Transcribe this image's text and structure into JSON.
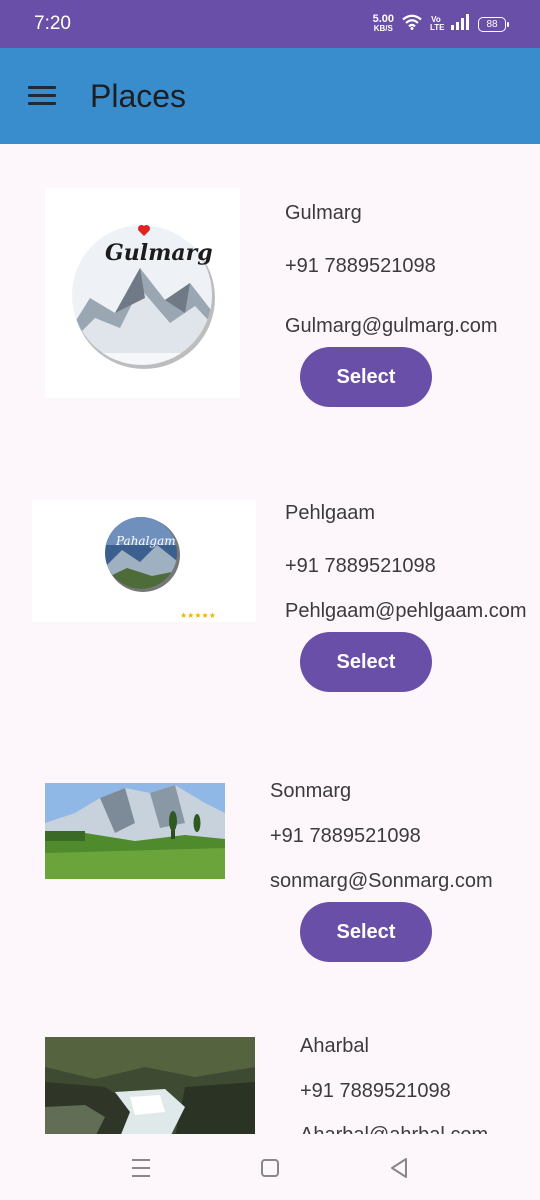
{
  "status_bar": {
    "time": "7:20",
    "net_speed_value": "5.00",
    "net_speed_unit": "KB/S",
    "volte_top": "Vo",
    "volte_bottom": "LTE",
    "battery": "88"
  },
  "app_bar": {
    "title": "Places",
    "menu_icon": "hamburger-menu-icon"
  },
  "places": [
    {
      "name": "Gulmarg",
      "phone": "+91 7889521098",
      "email": "Gulmarg@gulmarg.com",
      "select_label": "Select",
      "image_text": "Gulmarg"
    },
    {
      "name": "Pehlgaam",
      "phone": "+91 7889521098",
      "email": "Pehlgaam@pehlgaam.com",
      "select_label": "Select",
      "image_text": "Pahalgam"
    },
    {
      "name": "Sonmarg",
      "phone": "+91 7889521098",
      "email": "sonmarg@Sonmarg.com",
      "select_label": "Select"
    },
    {
      "name": "Aharbal",
      "phone": "+91 7889521098",
      "email": "Aharbal@ahrbal.com"
    }
  ],
  "nav_bar": {
    "recents_icon": "recents-icon",
    "home_icon": "home-icon",
    "back_icon": "back-icon"
  },
  "colors": {
    "status_bar": "#6a4fa8",
    "app_bar": "#3a8dcc",
    "button": "#6a4fa8",
    "background": "#fdf7fc"
  }
}
